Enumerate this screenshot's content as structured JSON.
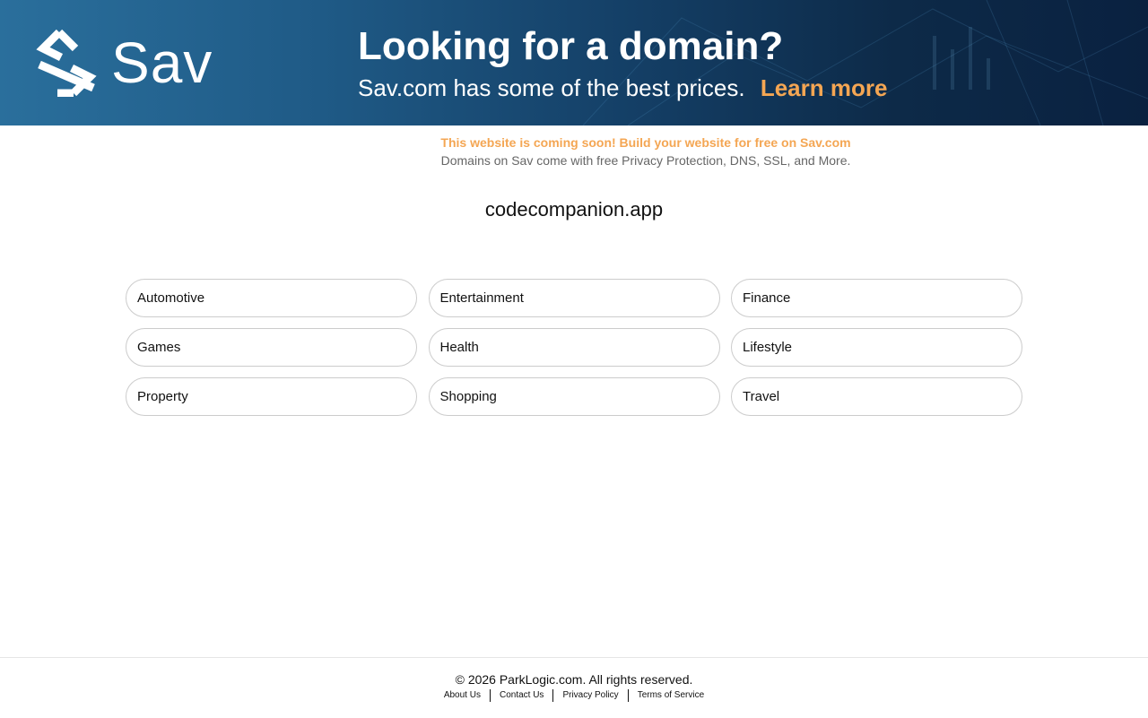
{
  "banner": {
    "logo_text": "Sav",
    "title": "Looking for a domain?",
    "subtitle": "Sav.com has some of the best prices.",
    "cta": "Learn more"
  },
  "notice": {
    "headline": "This website is coming soon! Build your website for free on Sav.com",
    "details": "Domains on Sav come with free Privacy Protection, DNS, SSL, and More."
  },
  "domain": "codecompanion.app",
  "categories": [
    "Automotive",
    "Entertainment",
    "Finance",
    "Games",
    "Health",
    "Lifestyle",
    "Property",
    "Shopping",
    "Travel"
  ],
  "footer": {
    "copyright": "© 2026 ParkLogic.com. All rights reserved.",
    "links": [
      "About Us",
      "Contact Us",
      "Privacy Policy",
      "Terms of Service"
    ]
  },
  "colors": {
    "accent": "#f4a653",
    "banner_dark": "#0a2140",
    "banner_light": "#2a6f9c"
  }
}
